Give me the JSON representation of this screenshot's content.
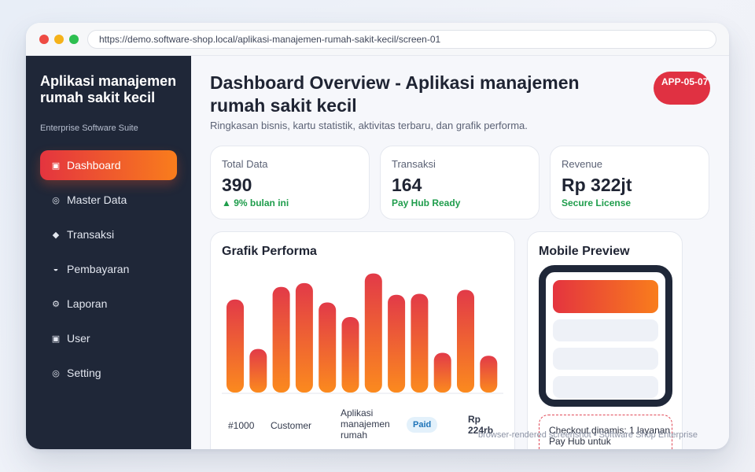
{
  "browser": {
    "url": "https://demo.software-shop.local/aplikasi-manajemen-rumah-sakit-kecil/screen-01"
  },
  "sidebar": {
    "app_title": "Aplikasi manajemen rumah sakit kecil",
    "subtitle": "Enterprise Software Suite",
    "items": [
      {
        "label": "Dashboard",
        "icon": "▣",
        "active": true
      },
      {
        "label": "Master Data",
        "icon": "◎",
        "active": false
      },
      {
        "label": "Transaksi",
        "icon": "◆",
        "active": false
      },
      {
        "label": "Pembayaran",
        "icon": "◒",
        "active": false
      },
      {
        "label": "Laporan",
        "icon": "⚙",
        "active": false
      },
      {
        "label": "User",
        "icon": "▣",
        "active": false
      },
      {
        "label": "Setting",
        "icon": "◎",
        "active": false
      }
    ]
  },
  "header": {
    "title": "Dashboard Overview - Aplikasi manajemen rumah sakit kecil",
    "subtitle": "Ringkasan bisnis, kartu statistik, aktivitas terbaru, dan grafik performa.",
    "badge": "APP-05-07"
  },
  "stats": [
    {
      "label": "Total Data",
      "value": "390",
      "note": "▲ 9% bulan ini"
    },
    {
      "label": "Transaksi",
      "value": "164",
      "note": "Pay Hub Ready"
    },
    {
      "label": "Revenue",
      "value": "Rp 322jt",
      "note": "Secure License"
    }
  ],
  "performance": {
    "title": "Grafik Performa",
    "row": {
      "id": "#1000",
      "customer": "Customer",
      "product": "Aplikasi manajemen rumah",
      "status": "Paid",
      "amount": "Rp 224rb"
    }
  },
  "chart_data": {
    "type": "bar",
    "categories": [
      "",
      "",
      "",
      "",
      "",
      "",
      "",
      "",
      "",
      "",
      "",
      ""
    ],
    "values": [
      96,
      45,
      109,
      113,
      93,
      78,
      123,
      101,
      102,
      41,
      106,
      38
    ],
    "ylim": [
      0,
      130
    ],
    "colors": {
      "top": "#e23a48",
      "bottom": "#fb8a1e"
    }
  },
  "mobile": {
    "title": "Mobile Preview",
    "checkout_text": "Checkout dinamis: 1 layanan Pay Hub untuk"
  },
  "footer": {
    "note": "browser-rendered screenshot • Software Shop Enterprise"
  },
  "colors": {
    "accent_start": "#e4343f",
    "accent_end": "#f97d1c",
    "sidebar_bg": "#1f2738",
    "positive": "#1f9d4c"
  }
}
